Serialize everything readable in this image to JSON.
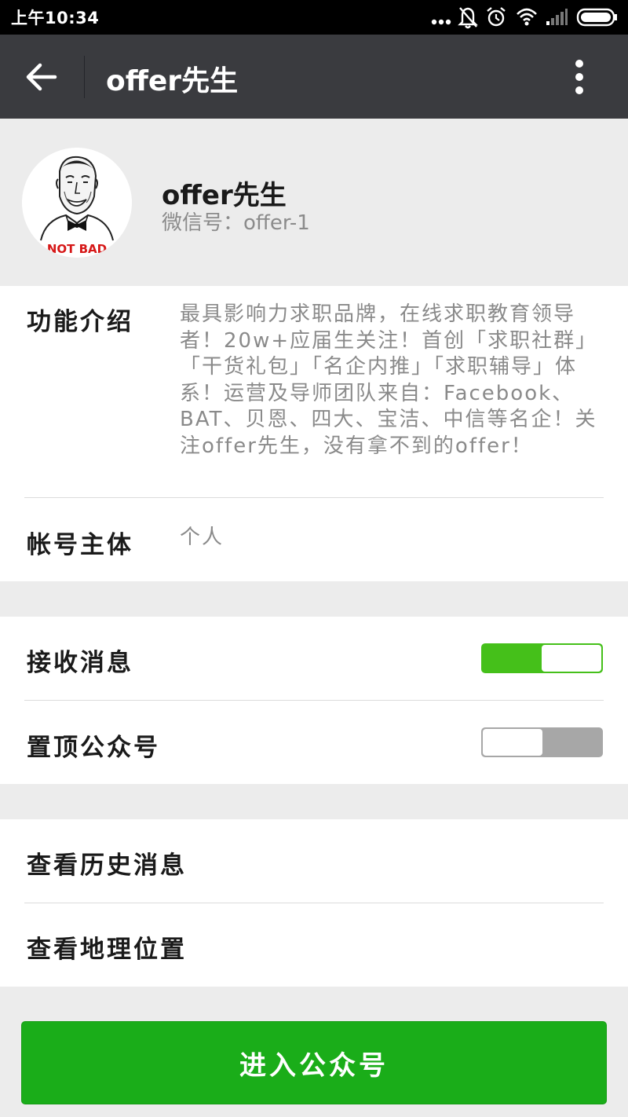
{
  "status_bar": {
    "time": "上午10:34",
    "icons": [
      "more-dots-icon",
      "bell-muted-icon",
      "alarm-icon",
      "wifi-icon",
      "signal-icon",
      "battery-icon"
    ]
  },
  "title_bar": {
    "title": "offer先生"
  },
  "profile": {
    "name": "offer先生",
    "wechat_id": "微信号：offer-1",
    "avatar_caption": "NOT BAD"
  },
  "info": {
    "intro_label": "功能介绍",
    "intro_text": "最具影响力求职品牌，在线求职教育领导者！20w+应届生关注！首创「求职社群」「干货礼包」「名企内推」「求职辅导」体系！运营及导师团队来自：Facebook、BAT、贝恩、四大、宝洁、中信等名企！关注offer先生，没有拿不到的offer！",
    "owner_label": "帐号主体",
    "owner_value": "个人"
  },
  "settings": {
    "receive_label": "接收消息",
    "receive_on": true,
    "pin_label": "置顶公众号",
    "pin_on": false
  },
  "links": {
    "history_label": "查看历史消息",
    "location_label": "查看地理位置"
  },
  "enter_button": "进入公众号",
  "colors": {
    "accent_green": "#1aad19",
    "toggle_on": "#45c01a",
    "title_bar": "#3a3b3f"
  }
}
